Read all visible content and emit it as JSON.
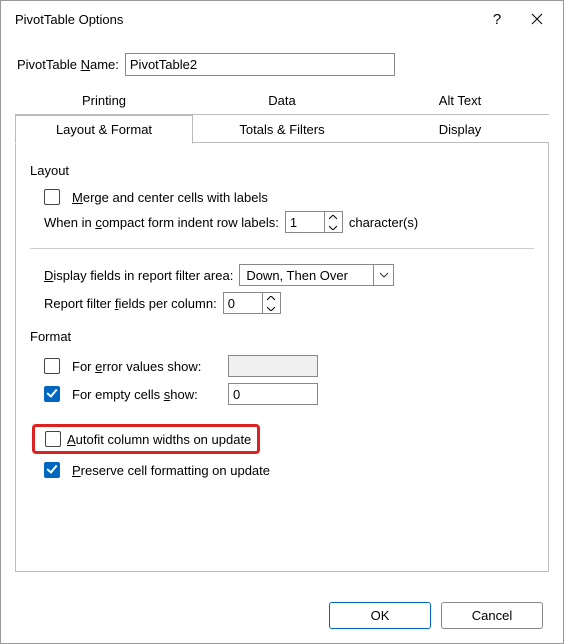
{
  "window": {
    "title": "PivotTable Options",
    "help_icon": "?",
    "name_label": "PivotTable Name:",
    "name_value": "PivotTable2"
  },
  "tabs": {
    "row1": [
      "Printing",
      "Data",
      "Alt Text"
    ],
    "row2": [
      "Layout & Format",
      "Totals & Filters",
      "Display"
    ],
    "active": "Layout & Format"
  },
  "layout": {
    "section_label": "Layout",
    "merge_label": "Merge and center cells with labels",
    "merge_checked": false,
    "indent_label_pre": "When in compact form indent row labels:",
    "indent_value": "1",
    "indent_label_post": "character(s)",
    "filter_label": "Display fields in report filter area:",
    "filter_selected": "Down, Then Over",
    "fields_per_col_label": "Report filter fields per column:",
    "fields_per_col_value": "0"
  },
  "format": {
    "section_label": "Format",
    "error_label": "For error values show:",
    "error_checked": false,
    "error_value": "",
    "empty_label": "For empty cells show:",
    "empty_checked": true,
    "empty_value": "0",
    "autofit_label": "Autofit column widths on update",
    "autofit_checked": false,
    "preserve_label": "Preserve cell formatting on update",
    "preserve_checked": true
  },
  "buttons": {
    "ok": "OK",
    "cancel": "Cancel"
  }
}
